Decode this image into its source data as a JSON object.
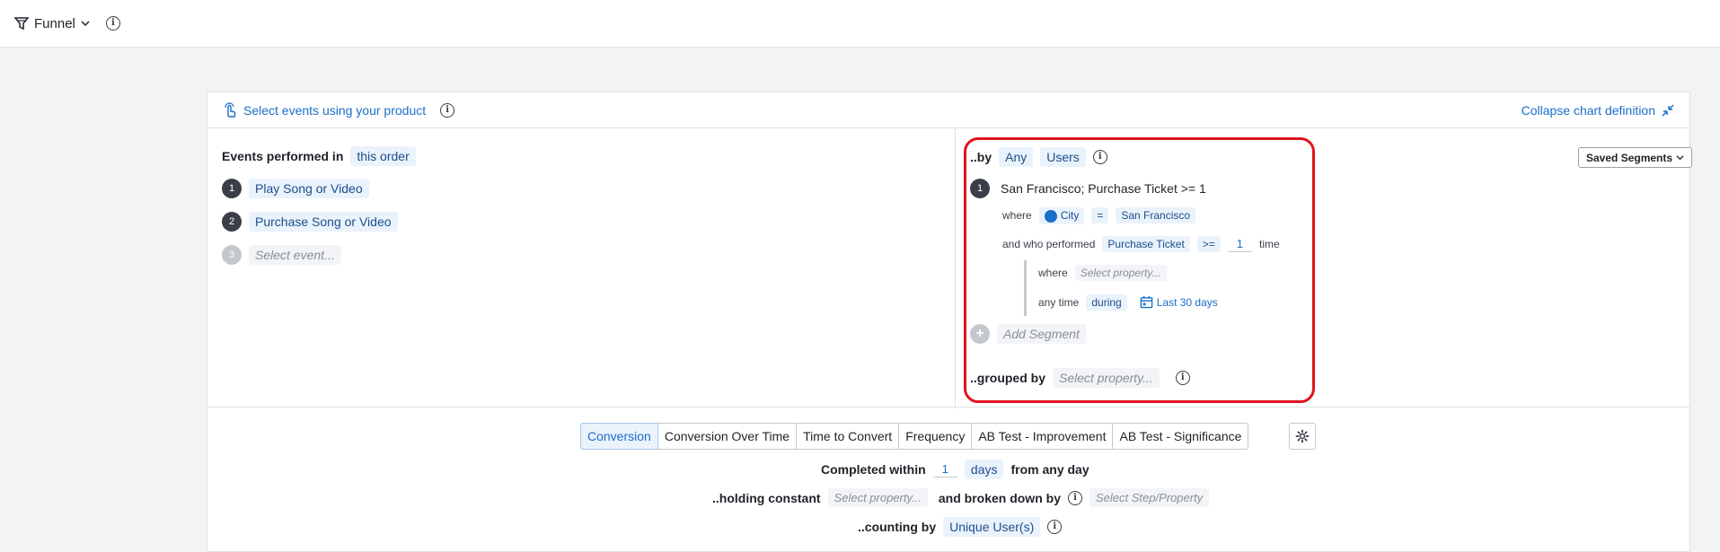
{
  "topbar": {
    "chart_type": "Funnel"
  },
  "header": {
    "select_events": "Select events using your product",
    "collapse": "Collapse chart definition"
  },
  "events": {
    "title": "Events performed in",
    "order": "this order",
    "steps": [
      {
        "num": "1",
        "label": "Play Song or Video"
      },
      {
        "num": "2",
        "label": "Purchase Song or Video"
      },
      {
        "num": "3",
        "label": "Select event..."
      }
    ]
  },
  "segments": {
    "by_label": "..by",
    "any": "Any",
    "users": "Users",
    "saved_segments": "Saved Segments",
    "segment": {
      "num": "1",
      "title": "San Francisco; Purchase Ticket >= 1",
      "where": "where",
      "city": "City",
      "eq": "=",
      "city_value": "San Francisco",
      "and_who_performed": "and who performed",
      "event": "Purchase Ticket",
      "op": ">=",
      "count": "1",
      "time": "time",
      "inner_where": "where",
      "select_property": "Select property...",
      "any_time": "any time",
      "during": "during",
      "range": "Last 30 days"
    },
    "add_segment": "Add Segment",
    "grouped_by": "..grouped by",
    "grouped_placeholder": "Select property..."
  },
  "tabs": [
    "Conversion",
    "Conversion Over Time",
    "Time to Convert",
    "Frequency",
    "AB Test - Improvement",
    "AB Test - Significance"
  ],
  "options": {
    "completed_within": "Completed within",
    "days_value": "1",
    "days_unit": "days",
    "from_any_day": "from any day",
    "holding_constant": "..holding constant",
    "holding_placeholder": "Select property...",
    "broken_down_by": "and broken down by",
    "broken_placeholder": "Select Step/Property",
    "counting_by": "..counting by",
    "counting_value": "Unique User(s)"
  },
  "colors": {
    "accent": "#1a6fc9",
    "highlight": "#e0141e"
  }
}
